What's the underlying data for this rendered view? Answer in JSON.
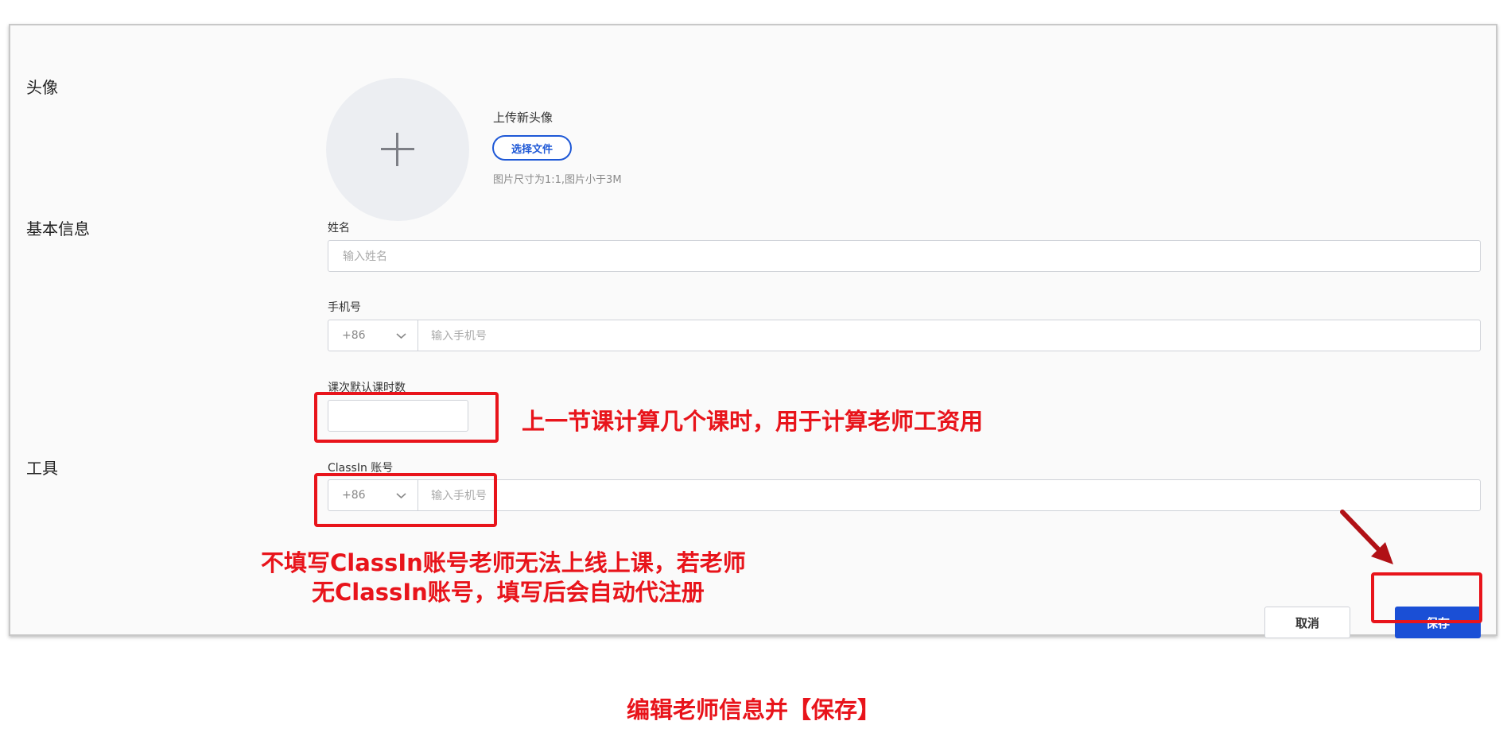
{
  "form": {
    "sections": {
      "avatar": "头像",
      "basic_info": "基本信息",
      "tools": "工具"
    },
    "avatar": {
      "upload_title": "上传新头像",
      "choose_file_label": "选择文件",
      "hint": "图片尺寸为1:1,图片小于3M"
    },
    "name": {
      "label": "姓名",
      "placeholder": "输入姓名"
    },
    "phone": {
      "label": "手机号",
      "country_code": "+86",
      "placeholder": "输入手机号"
    },
    "lesson_hours": {
      "label": "课次默认课时数",
      "value": ""
    },
    "classin": {
      "label": "ClassIn 账号",
      "country_code": "+86",
      "placeholder": "输入手机号"
    },
    "cancel_label": "取消",
    "save_label": "保存"
  },
  "annotations": {
    "lesson_hours_note": "上一节课计算几个课时，用于计算老师工资用",
    "classin_note_line1": "不填写ClassIn账号老师无法上线上课，若老师",
    "classin_note_line2": "无ClassIn账号，填写后会自动代注册",
    "caption": "编辑老师信息并【保存】"
  },
  "colors": {
    "annotation_red": "#e8141b",
    "primary_blue": "#1a4fd6"
  }
}
